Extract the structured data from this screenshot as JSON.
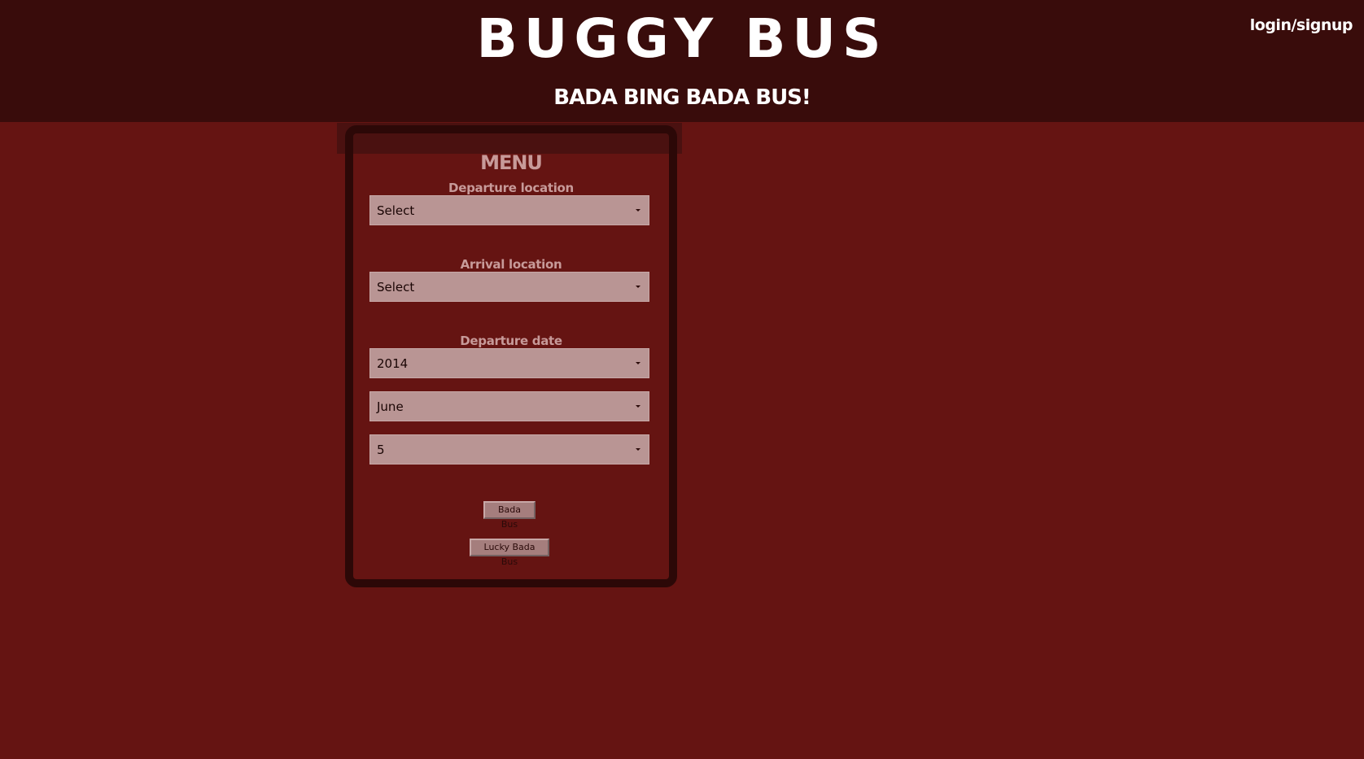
{
  "header": {
    "title": "BUGGY BUS",
    "tagline": "BADA BING BADA BUS!",
    "login_link": "login/signup"
  },
  "menu": {
    "title": "MENU",
    "departure_location": {
      "label": "Departure location",
      "value": "Select"
    },
    "arrival_location": {
      "label": "Arrival location",
      "value": "Select"
    },
    "departure_date": {
      "label": "Departure date",
      "year": "2014",
      "month": "June",
      "day": "5"
    },
    "buttons": {
      "bada_bus": "Bada Bus",
      "lucky_bada_bus": "Lucky Bada Bus"
    }
  },
  "colors": {
    "background": "#651412",
    "header": "#390c0b",
    "panel_border": "#2c0807",
    "label": "#c79a99",
    "select_fill": "#b99594"
  }
}
